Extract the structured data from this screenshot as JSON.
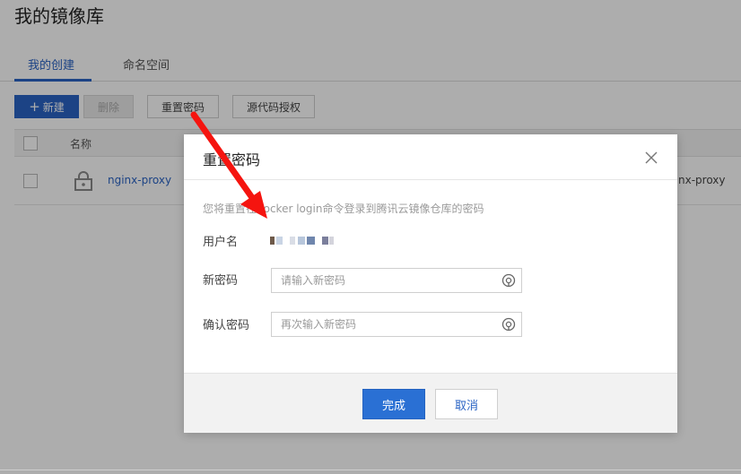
{
  "page": {
    "title": "我的镜像库",
    "tabs": [
      {
        "label": "我的创建",
        "active": true
      },
      {
        "label": "命名空间",
        "active": false
      }
    ]
  },
  "toolbar": {
    "new_label": "新建",
    "new_icon": "plus-icon",
    "delete_label": "删除",
    "reset_password_label": "重置密码",
    "source_auth_label": "源代码授权"
  },
  "table": {
    "columns": [
      "名称"
    ],
    "rows": [
      {
        "name": "nginx-proxy",
        "icon": "lock-icon",
        "extra": "nx-proxy"
      }
    ]
  },
  "modal": {
    "title": "重置密码",
    "description": "您将重置在docker login命令登录到腾讯云镜像仓库的密码",
    "username_label": "用户名",
    "new_password_label": "新密码",
    "new_password_placeholder": "请输入新密码",
    "confirm_password_label": "确认密码",
    "confirm_password_placeholder": "再次输入新密码",
    "done_label": "完成",
    "cancel_label": "取消"
  },
  "colors": {
    "primary": "#2a63c4",
    "button_primary": "#2a70d4",
    "arrow": "#f5140f"
  }
}
